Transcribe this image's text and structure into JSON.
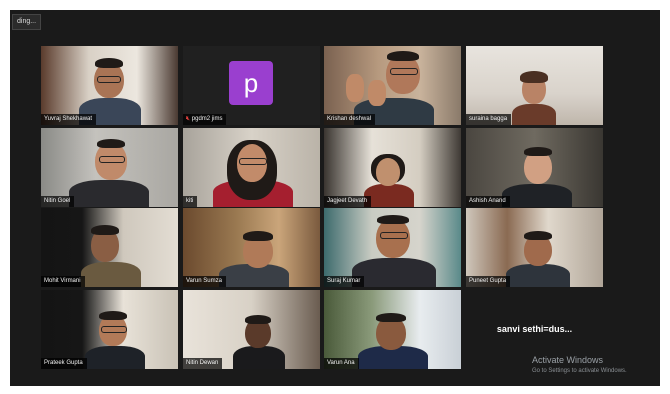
{
  "toolbar": {
    "recording_label": "ding..."
  },
  "participants": [
    {
      "name": "Yuvraj Shekhawat"
    },
    {
      "name": "pgdm2 jims",
      "muted": true,
      "avatar_letter": "p",
      "avatar_color": "#9a3fcf"
    },
    {
      "name": "Krishan deshwal",
      "active_speaker": true
    },
    {
      "name": "suraina bagga"
    },
    {
      "name": "Nitin Goel"
    },
    {
      "name": "kiti"
    },
    {
      "name": "Jagjeet Devath"
    },
    {
      "name": "Ashish Anand"
    },
    {
      "name": "Mohit Virmani"
    },
    {
      "name": "Varun Sumza"
    },
    {
      "name": "Suraj Kumar"
    },
    {
      "name": "Puneet Gupta"
    },
    {
      "name": "Prateek Gupta"
    },
    {
      "name": "Nitin Dewan"
    },
    {
      "name": "Varun Ana"
    },
    {
      "name": "sanvi sethi=dus..."
    }
  ],
  "watermark": {
    "title": "Activate Windows",
    "subtitle": "Go to Settings to activate Windows."
  },
  "colors": {
    "active_border": "#c6d24a",
    "mute_icon": "#e0413e"
  }
}
